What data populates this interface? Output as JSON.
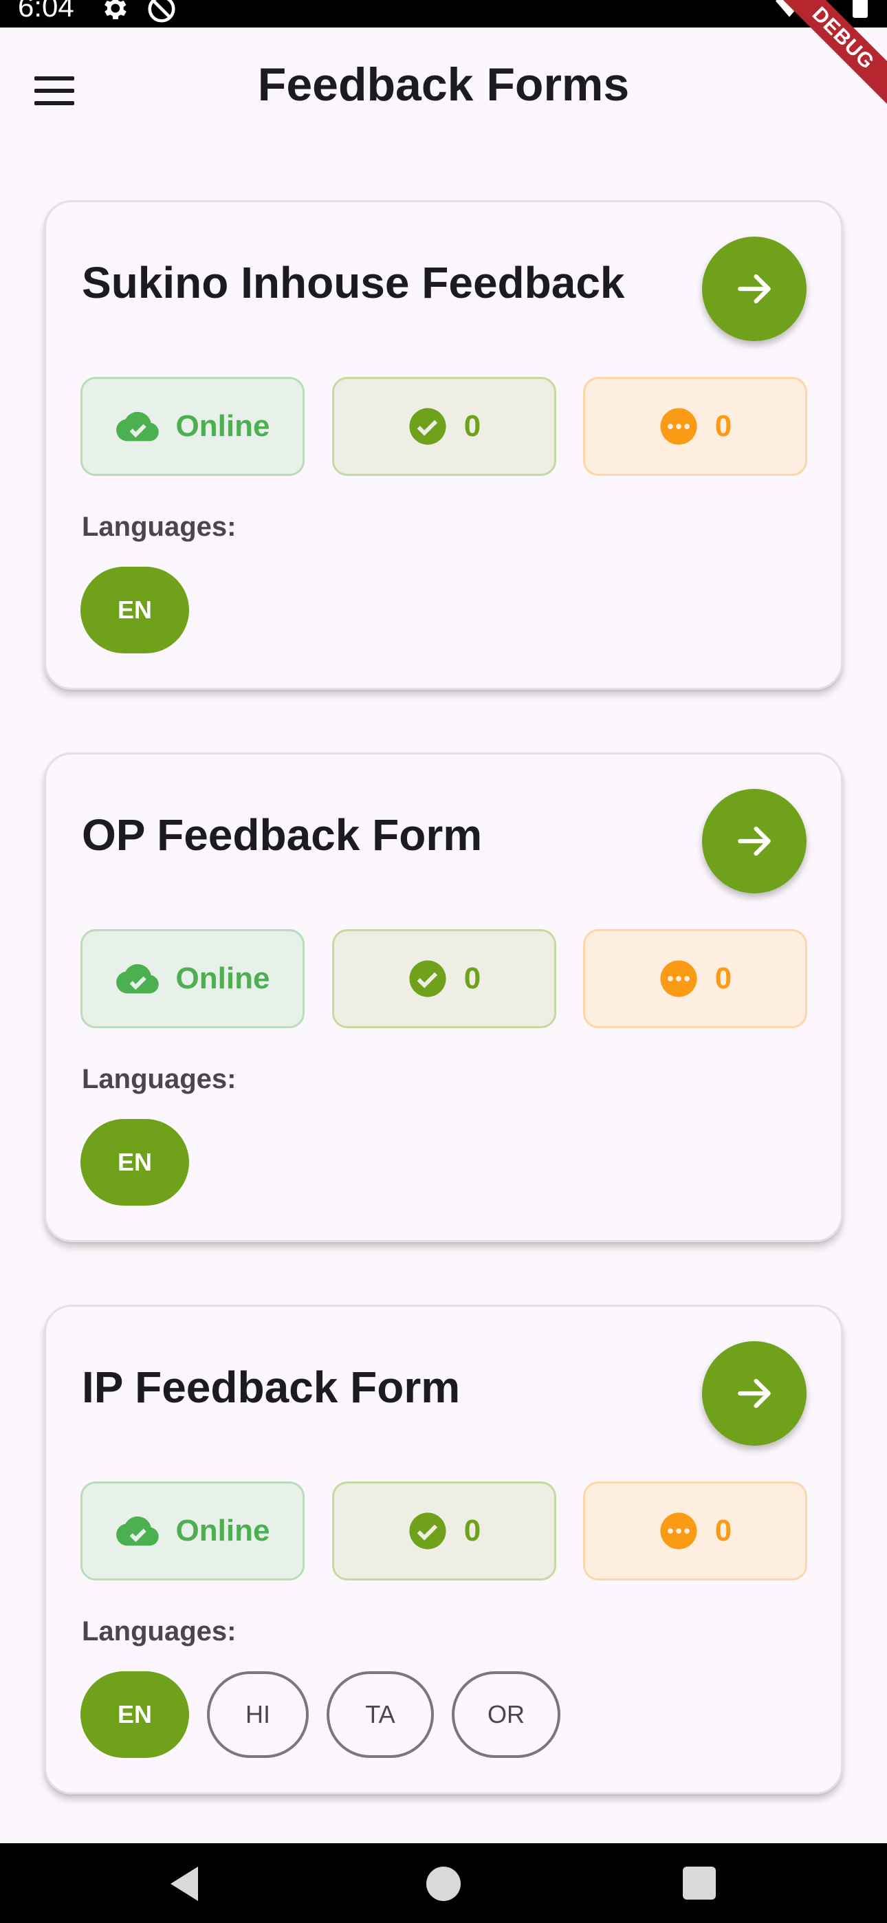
{
  "status_bar": {
    "time": "6:04",
    "icons": [
      "gear-icon",
      "do-not-disturb-icon",
      "wifi-icon",
      "battery-icon"
    ]
  },
  "debug_banner": "DEBUG",
  "app_bar": {
    "title": "Feedback Forms",
    "menu_icon": "hamburger-menu-icon"
  },
  "colors": {
    "primary": "#6fa11a",
    "online": "#4caf50",
    "pending": "#fa9a15",
    "background": "#fcf7fc"
  },
  "forms": [
    {
      "title": "Sukino Inhouse Feedback",
      "status": "Online",
      "completed": "0",
      "pending": "0",
      "languages_label": "Languages:",
      "languages": [
        {
          "code": "EN",
          "active": true
        }
      ]
    },
    {
      "title": "OP Feedback Form",
      "status": "Online",
      "completed": "0",
      "pending": "0",
      "languages_label": "Languages:",
      "languages": [
        {
          "code": "EN",
          "active": true
        }
      ]
    },
    {
      "title": "IP Feedback Form",
      "status": "Online",
      "completed": "0",
      "pending": "0",
      "languages_label": "Languages:",
      "languages": [
        {
          "code": "EN",
          "active": true
        },
        {
          "code": "HI",
          "active": false
        },
        {
          "code": "TA",
          "active": false
        },
        {
          "code": "OR",
          "active": false
        }
      ]
    }
  ],
  "nav_bar": {
    "buttons": [
      "back-icon",
      "home-icon",
      "recents-icon"
    ]
  }
}
